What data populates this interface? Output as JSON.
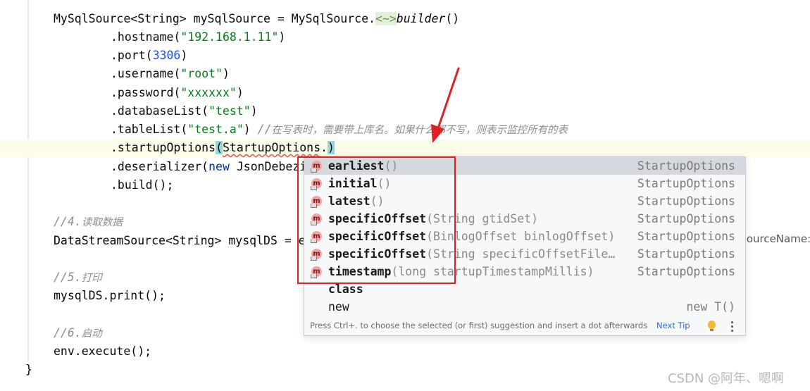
{
  "code": {
    "l1": {
      "t1": "MySqlSource<String> mySqlSource = MySqlSource.",
      "diamond": "<~>",
      "builder": "builder",
      "t2": "()"
    },
    "l2": {
      "a": ".hostname(",
      "s": "\"192.168.1.11\"",
      "b": ")"
    },
    "l3": {
      "a": ".port(",
      "n": "3306",
      "b": ")"
    },
    "l4": {
      "a": ".username(",
      "s": "\"root\"",
      "b": ")"
    },
    "l5": {
      "a": ".password(",
      "s": "\"xxxxxx\"",
      "b": ")"
    },
    "l6": {
      "a": ".databaseList(",
      "s": "\"test\"",
      "b": ")"
    },
    "l7": {
      "a": ".tableList(",
      "s": "\"test.a\"",
      "b": ") ",
      "c1": "//",
      "c2": "在写表时，需要带上库名。如果什么都不写，则表示监控所有的表"
    },
    "l8": {
      "a": ".startupOptions",
      "p": "(",
      "w": "StartupOptions",
      "b": ".",
      "q": ")"
    },
    "l9": {
      "a": ".deserializer(",
      "kw": "new",
      "b": " JsonDebezi"
    },
    "l10": {
      "a": ".build();"
    },
    "l11": {
      "c1": "//4.",
      "c2": "读取数据"
    },
    "l12": {
      "a": "DataStreamSource<String> mysqlDS = e"
    },
    "l13": {
      "c1": "//5.",
      "c2": "打印"
    },
    "l14": {
      "a": "mysqlDS.print();"
    },
    "l15": {
      "c1": "//6.",
      "c2": "启动"
    },
    "l16": {
      "a": "env.execute();"
    },
    "l17": {
      "a": "}"
    }
  },
  "overflow_text": "sourceName:",
  "popup": {
    "items": [
      {
        "icon": "m",
        "name": "earliest",
        "params": "()",
        "type": "StartupOptions"
      },
      {
        "icon": "m",
        "name": "initial",
        "params": "()",
        "type": "StartupOptions"
      },
      {
        "icon": "m",
        "name": "latest",
        "params": "()",
        "type": "StartupOptions"
      },
      {
        "icon": "m",
        "name": "specificOffset",
        "params": "(String gtidSet)",
        "type": "StartupOptions"
      },
      {
        "icon": "m",
        "name": "specificOffset",
        "params": "(BinlogOffset binlogOffset)",
        "type": "StartupOptions"
      },
      {
        "icon": "m",
        "name": "specificOffset",
        "params": "(String specificOffsetFile…",
        "type": "StartupOptions"
      },
      {
        "icon": "m",
        "name": "timestamp",
        "params": "(long startupTimestampMillis)",
        "type": "StartupOptions"
      },
      {
        "icon": "",
        "name": "class",
        "params": "",
        "type": ""
      },
      {
        "icon": "",
        "name": "new",
        "params": "",
        "type": "new T()"
      }
    ],
    "footer_text": "Press Ctrl+. to choose the selected (or first) suggestion and insert a dot afterwards",
    "footer_link": "Next Tip"
  },
  "watermark": "CSDN @阿年、嗯啊",
  "colors": {
    "highlight_box": "#e01f1f",
    "arrow": "#e01f1f",
    "string": "#067d17",
    "number": "#1750eb",
    "keyword": "#0033b3",
    "comment": "#8c8c8c"
  }
}
